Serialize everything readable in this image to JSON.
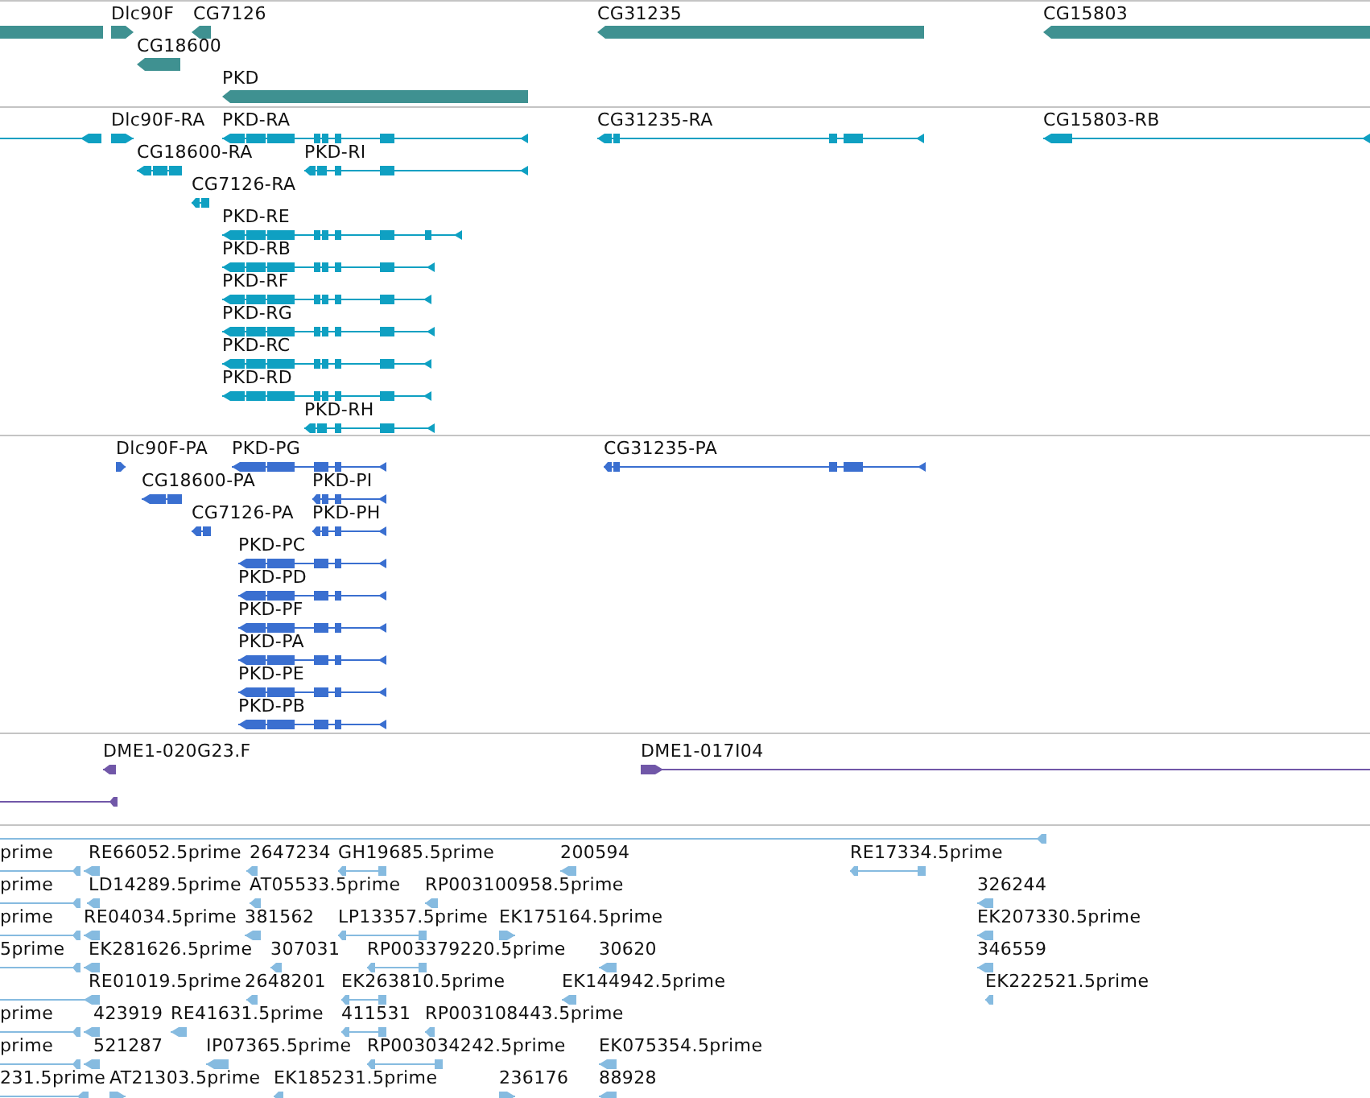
{
  "tracks": [
    {
      "kind": "gene",
      "color": "#3f9191",
      "features": [
        {
          "reverse": true
        },
        {
          "label": "Dlc90F",
          "reverse": false
        },
        {
          "label": "CG7126",
          "reverse": true
        },
        {
          "label": "CG31235",
          "reverse": true
        },
        {
          "label": "CG15803",
          "reverse": true
        },
        {
          "label": "CG18600",
          "reverse": true
        },
        {
          "label": "PKD",
          "reverse": true
        }
      ]
    },
    {
      "kind": "transcript",
      "color": "#0fa0c2",
      "features": [
        {
          "reverse": true
        },
        {
          "label": "Dlc90F-RA",
          "reverse": false
        },
        {
          "label": "PKD-RA",
          "reverse": true
        },
        {
          "label": "CG31235-RA",
          "reverse": true
        },
        {
          "label": "CG15803-RB",
          "reverse": true
        },
        {
          "label": "CG18600-RA",
          "reverse": true
        },
        {
          "label": "PKD-RI",
          "reverse": true
        },
        {
          "label": "CG7126-RA",
          "reverse": true
        },
        {
          "label": "PKD-RE",
          "reverse": true
        },
        {
          "label": "PKD-RB",
          "reverse": true
        },
        {
          "label": "PKD-RF",
          "reverse": true
        },
        {
          "label": "PKD-RG",
          "reverse": true
        },
        {
          "label": "PKD-RC",
          "reverse": true
        },
        {
          "label": "PKD-RD",
          "reverse": true
        },
        {
          "label": "PKD-RH",
          "reverse": true
        }
      ]
    },
    {
      "kind": "protein",
      "color": "#3a6fd0",
      "features": [
        {
          "label": "Dlc90F-PA",
          "reverse": false
        },
        {
          "label": "PKD-PG",
          "reverse": true
        },
        {
          "label": "CG31235-PA",
          "reverse": true
        },
        {
          "label": "CG18600-PA",
          "reverse": true
        },
        {
          "label": "PKD-PI",
          "reverse": true
        },
        {
          "label": "CG7126-PA",
          "reverse": true
        },
        {
          "label": "PKD-PH",
          "reverse": true
        },
        {
          "label": "PKD-PC",
          "reverse": true
        },
        {
          "label": "PKD-PD",
          "reverse": true
        },
        {
          "label": "PKD-PF",
          "reverse": true
        },
        {
          "label": "PKD-PA",
          "reverse": true
        },
        {
          "label": "PKD-PE",
          "reverse": true
        },
        {
          "label": "PKD-PB",
          "reverse": true
        }
      ]
    },
    {
      "kind": "clone",
      "color": "#7157a8",
      "features": [
        {
          "label": "DME1-020G23.F",
          "reverse": true
        },
        {
          "label": "DME1-017I04",
          "reverse": false
        },
        {
          "reverse": true
        }
      ]
    },
    {
      "kind": "est",
      "color": "#86bbe0",
      "features": [
        {
          "reverse": true
        },
        {
          "label": "prime",
          "reverse": true
        },
        {
          "label": "RE66052.5prime",
          "reverse": true
        },
        {
          "label": "2647234",
          "reverse": true
        },
        {
          "label": "GH19685.5prime",
          "reverse": true
        },
        {
          "label": "200594",
          "reverse": true
        },
        {
          "label": "RE17334.5prime",
          "reverse": true
        },
        {
          "label": "prime",
          "reverse": true
        },
        {
          "label": "LD14289.5prime",
          "reverse": true
        },
        {
          "label": "AT05533.5prime",
          "reverse": true
        },
        {
          "label": "RP003100958.5prime",
          "reverse": true
        },
        {
          "label": "326244",
          "reverse": true
        },
        {
          "label": "prime",
          "reverse": true
        },
        {
          "label": "RE04034.5prime",
          "reverse": true
        },
        {
          "label": "381562",
          "reverse": true
        },
        {
          "label": "LP13357.5prime",
          "reverse": true
        },
        {
          "label": "EK175164.5prime",
          "reverse": false
        },
        {
          "label": "EK207330.5prime",
          "reverse": true
        },
        {
          "label": "5prime",
          "reverse": true
        },
        {
          "label": "EK281626.5prime",
          "reverse": true
        },
        {
          "label": "307031",
          "reverse": true
        },
        {
          "label": "RP003379220.5prime",
          "reverse": true
        },
        {
          "label": "30620",
          "reverse": true
        },
        {
          "label": "346559",
          "reverse": true
        },
        {
          "label": "RE01019.5prime",
          "reverse": true
        },
        {
          "label": "2648201",
          "reverse": true
        },
        {
          "label": "EK263810.5prime",
          "reverse": true
        },
        {
          "label": "EK144942.5prime",
          "reverse": true
        },
        {
          "label": "EK222521.5prime",
          "reverse": true
        },
        {
          "label": "prime",
          "reverse": true
        },
        {
          "label": "423919",
          "reverse": true
        },
        {
          "label": "RE41631.5prime",
          "reverse": true
        },
        {
          "label": "411531",
          "reverse": true
        },
        {
          "label": "RP003108443.5prime",
          "reverse": true
        },
        {
          "label": "prime",
          "reverse": true
        },
        {
          "label": "521287",
          "reverse": true
        },
        {
          "label": "IP07365.5prime",
          "reverse": true
        },
        {
          "label": "RP003034242.5prime",
          "reverse": true
        },
        {
          "label": "EK075354.5prime",
          "reverse": true
        },
        {
          "label": "231.5prime",
          "reverse": true
        },
        {
          "label": "AT21303.5prime",
          "reverse": false
        },
        {
          "label": "EK185231.5prime",
          "reverse": true
        },
        {
          "label": "236176",
          "reverse": false
        },
        {
          "label": "88928",
          "reverse": true
        }
      ]
    }
  ]
}
